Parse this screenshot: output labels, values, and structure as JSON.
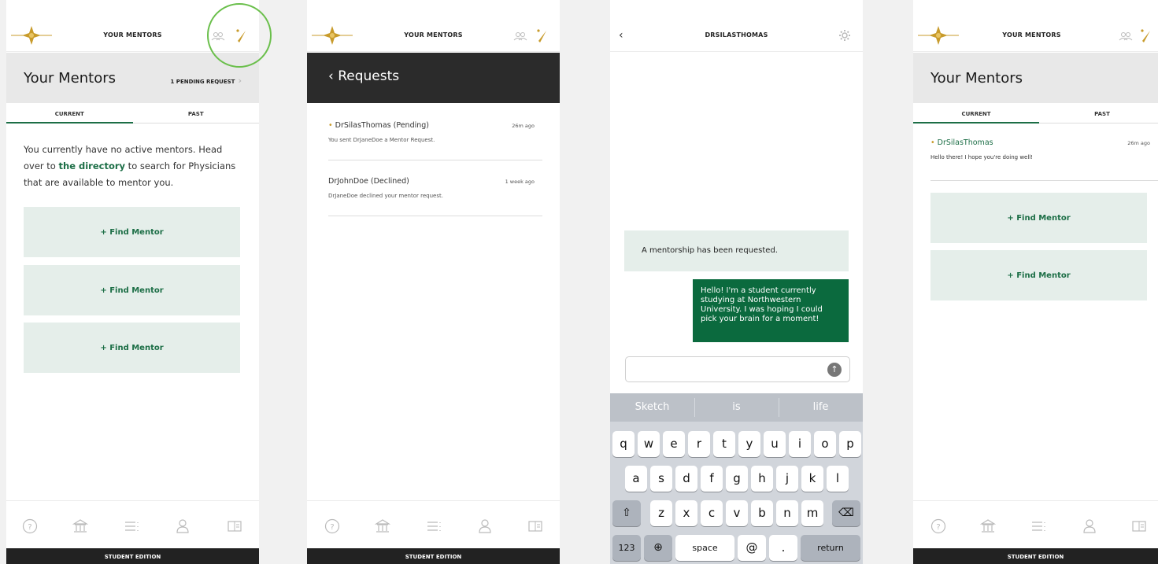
{
  "colors": {
    "accent": "#1c6e46",
    "gold": "#c89b2b",
    "dark": "#222222",
    "highlight": "#6abf4b"
  },
  "header_title": "YOUR MENTORS",
  "footer_label": "STUDENT EDITION",
  "tabbar_icons": [
    "help-icon",
    "institution-icon",
    "list-icon",
    "profile-icon",
    "book-icon"
  ],
  "screen1": {
    "title": "Your Mentors",
    "pending_label": "1 PENDING REQUEST",
    "tabs": [
      "CURRENT",
      "PAST"
    ],
    "empty_before": "You currently have no active mentors. Head over to ",
    "empty_link": "the directory",
    "empty_after": " to search for Physicians that are available to mentor you.",
    "buttons": [
      "+ Find Mentor",
      "+ Find Mentor",
      "+ Find Mentor"
    ]
  },
  "screen2": {
    "title": "Requests",
    "requests": [
      {
        "name": "DrSilasThomas (Pending)",
        "message": "You sent DrJaneDoe a Mentor Request.",
        "time": "26m ago",
        "dot": true
      },
      {
        "name": "DrJohnDoe (Declined)",
        "message": "DrJaneDoe declined your mentor request.",
        "time": "1 week ago",
        "dot": false
      }
    ]
  },
  "screen3": {
    "title": "DRSILASTHOMAS",
    "system_message": "A mentorship has been requested.",
    "bubble": "Hello! I'm a student currently studying at Northwestern University. I was hoping I could pick your brain for a moment!",
    "input_value": "",
    "suggestions": [
      "Sketch",
      "is",
      "life"
    ],
    "row1": [
      "q",
      "w",
      "e",
      "r",
      "t",
      "y",
      "u",
      "i",
      "o",
      "p"
    ],
    "row2": [
      "a",
      "s",
      "d",
      "f",
      "g",
      "h",
      "j",
      "k",
      "l"
    ],
    "row3": [
      "z",
      "x",
      "c",
      "v",
      "b",
      "n",
      "m"
    ],
    "num_key": "123",
    "space_key": "space",
    "at_key": "@",
    "dot_key": ".",
    "return_key": "return"
  },
  "screen4": {
    "title": "Your Mentors",
    "tabs": [
      "CURRENT",
      "PAST"
    ],
    "mentor": {
      "name": "DrSilasThomas",
      "message": "Hello there! I hope you're doing well!",
      "time": "26m ago"
    },
    "buttons": [
      "+ Find Mentor",
      "+ Find Mentor"
    ]
  }
}
